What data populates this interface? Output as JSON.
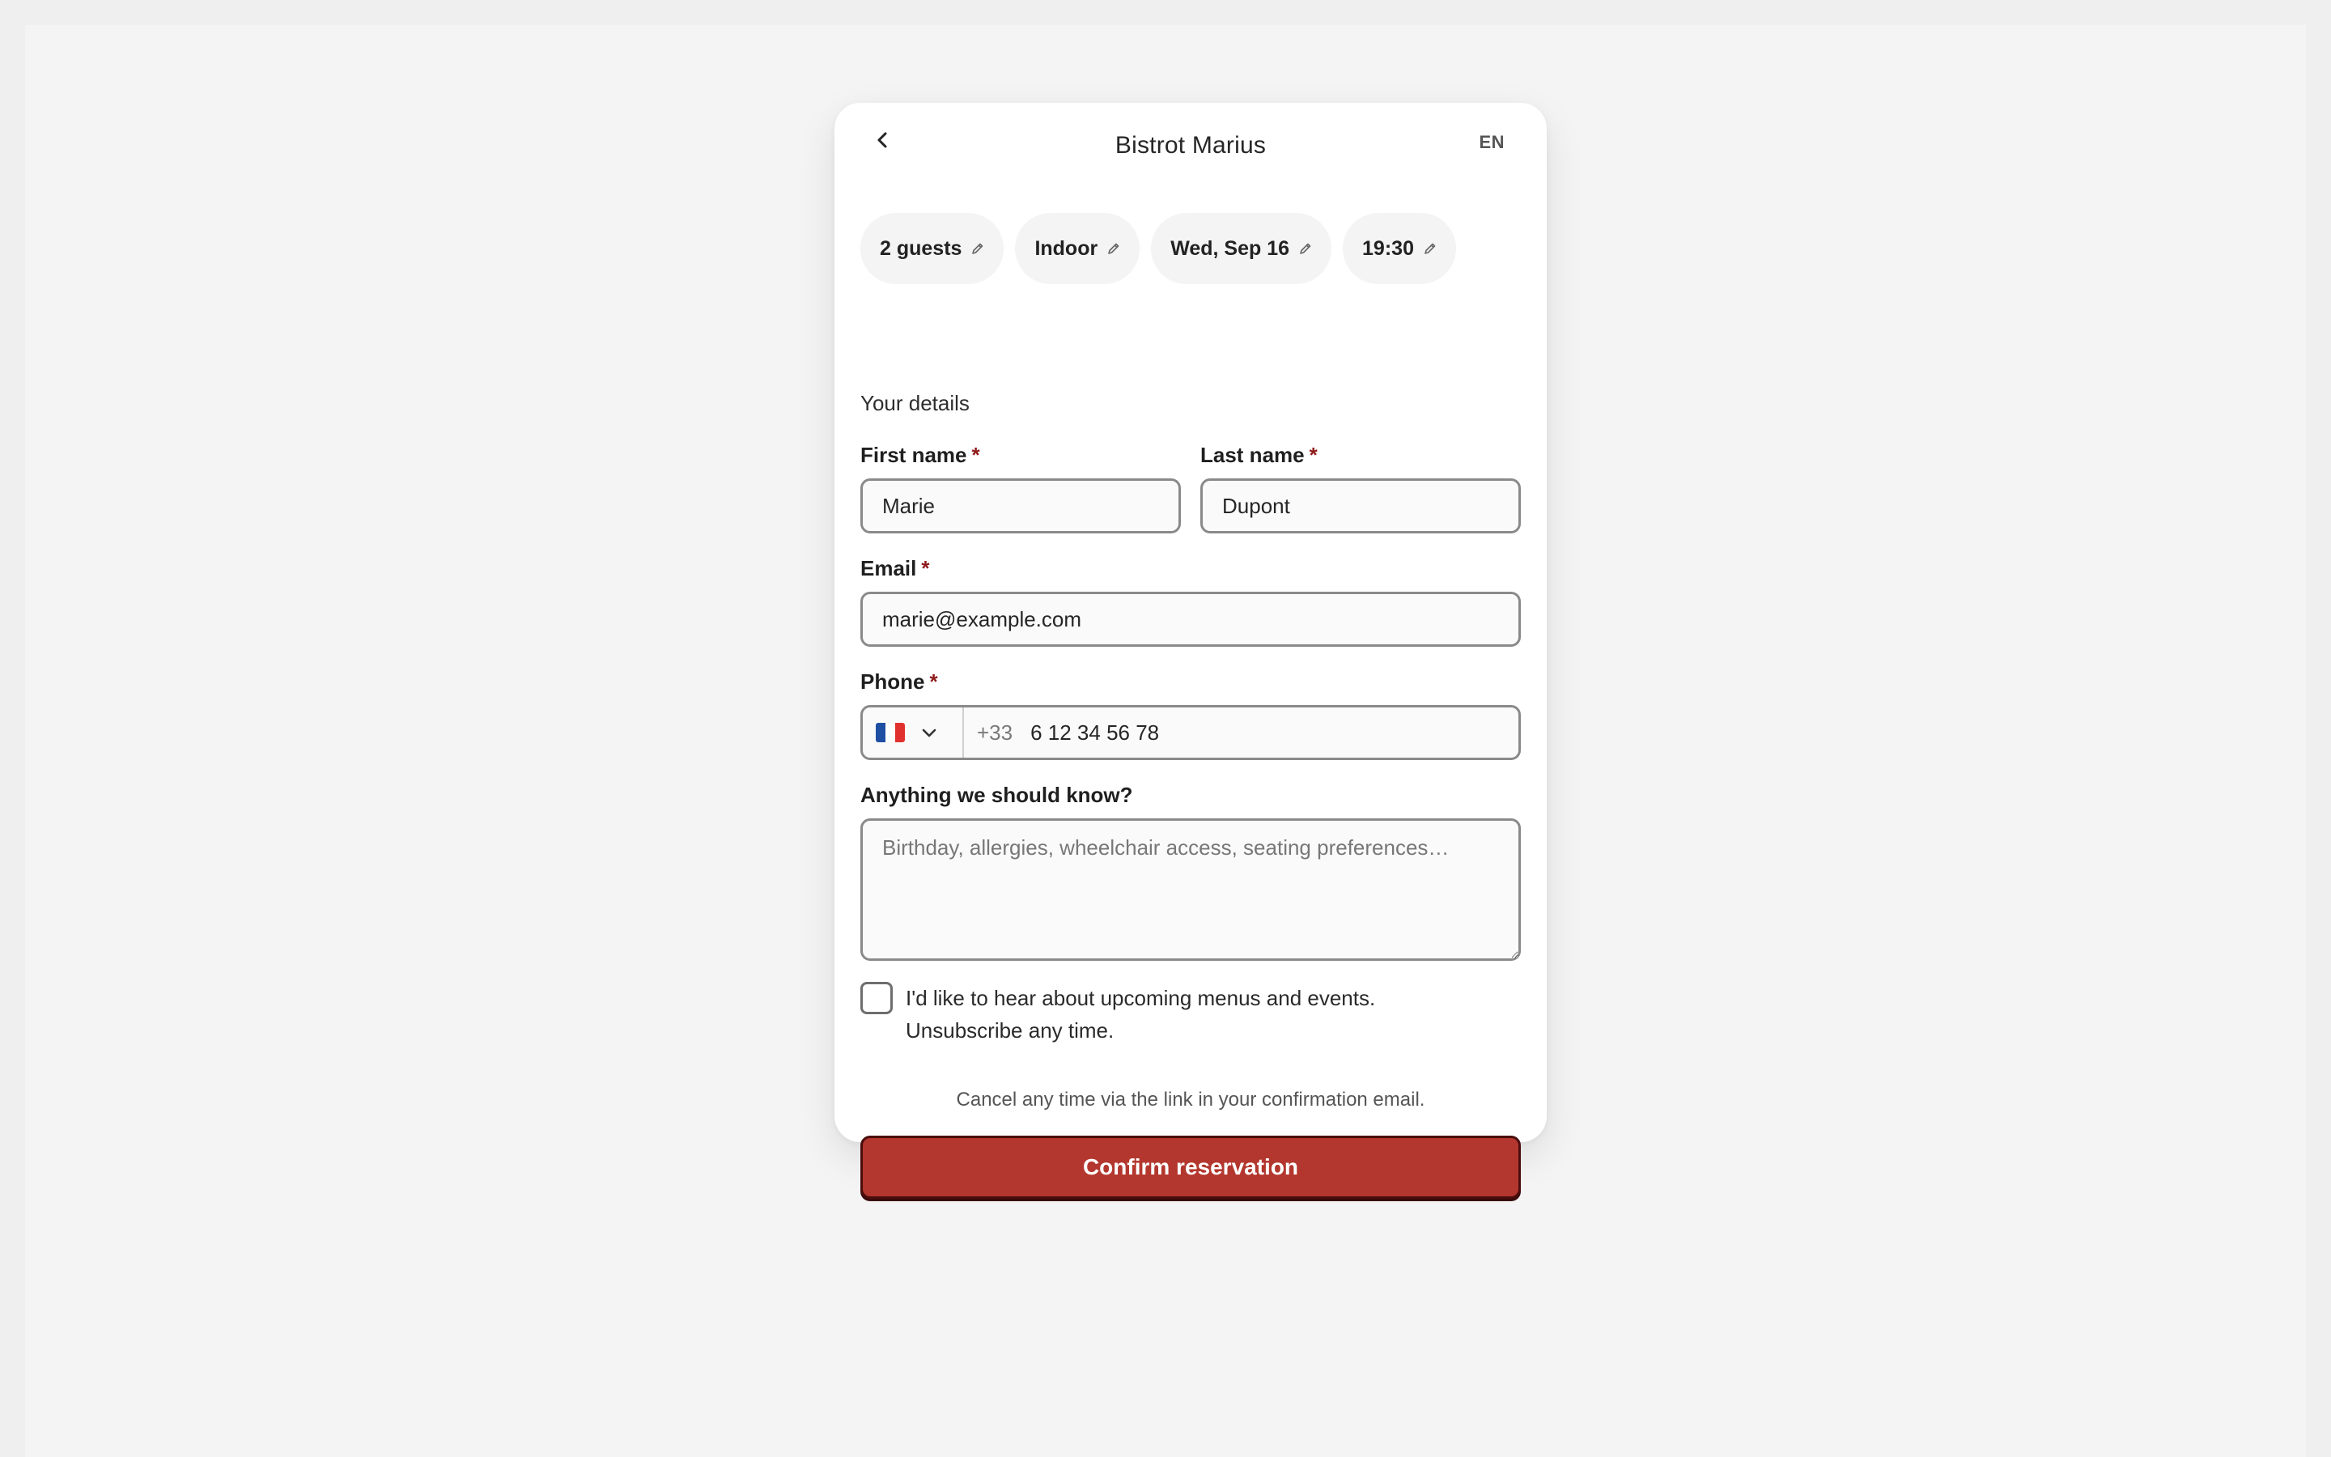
{
  "header": {
    "title": "Bistrot Marius",
    "language": "EN"
  },
  "chips": [
    {
      "label": "2 guests",
      "icon": "pencil-icon"
    },
    {
      "label": "Indoor",
      "icon": "pencil-icon"
    },
    {
      "label": "Wed, Sep 16",
      "icon": "pencil-icon"
    },
    {
      "label": "19:30",
      "icon": "pencil-icon"
    }
  ],
  "form": {
    "section_title": "Your details",
    "required_marker": "*",
    "first_name": {
      "label": "First name",
      "value": "Marie"
    },
    "last_name": {
      "label": "Last name",
      "value": "Dupont"
    },
    "email": {
      "label": "Email",
      "value": "marie@example.com"
    },
    "phone": {
      "label": "Phone",
      "country": "France",
      "dial_code": "+33",
      "value": "6 12 34 56 78"
    },
    "notes": {
      "label": "Anything we should know?",
      "placeholder": "Birthday, allergies, wheelchair access, seating preferences…",
      "value": ""
    },
    "newsletter": {
      "label": "I'd like to hear about upcoming menus and events. Unsubscribe any time.",
      "checked": false
    }
  },
  "footer": {
    "cancel_note": "Cancel any time via the link in your confirmation email.",
    "confirm_label": "Confirm reservation"
  },
  "colors": {
    "accent": "#b3372e",
    "required": "#8e1a1a",
    "chip_bg": "#f4f4f4",
    "flag_blue": "#1f4fa3",
    "flag_white": "#ffffff",
    "flag_red": "#e1312e"
  }
}
